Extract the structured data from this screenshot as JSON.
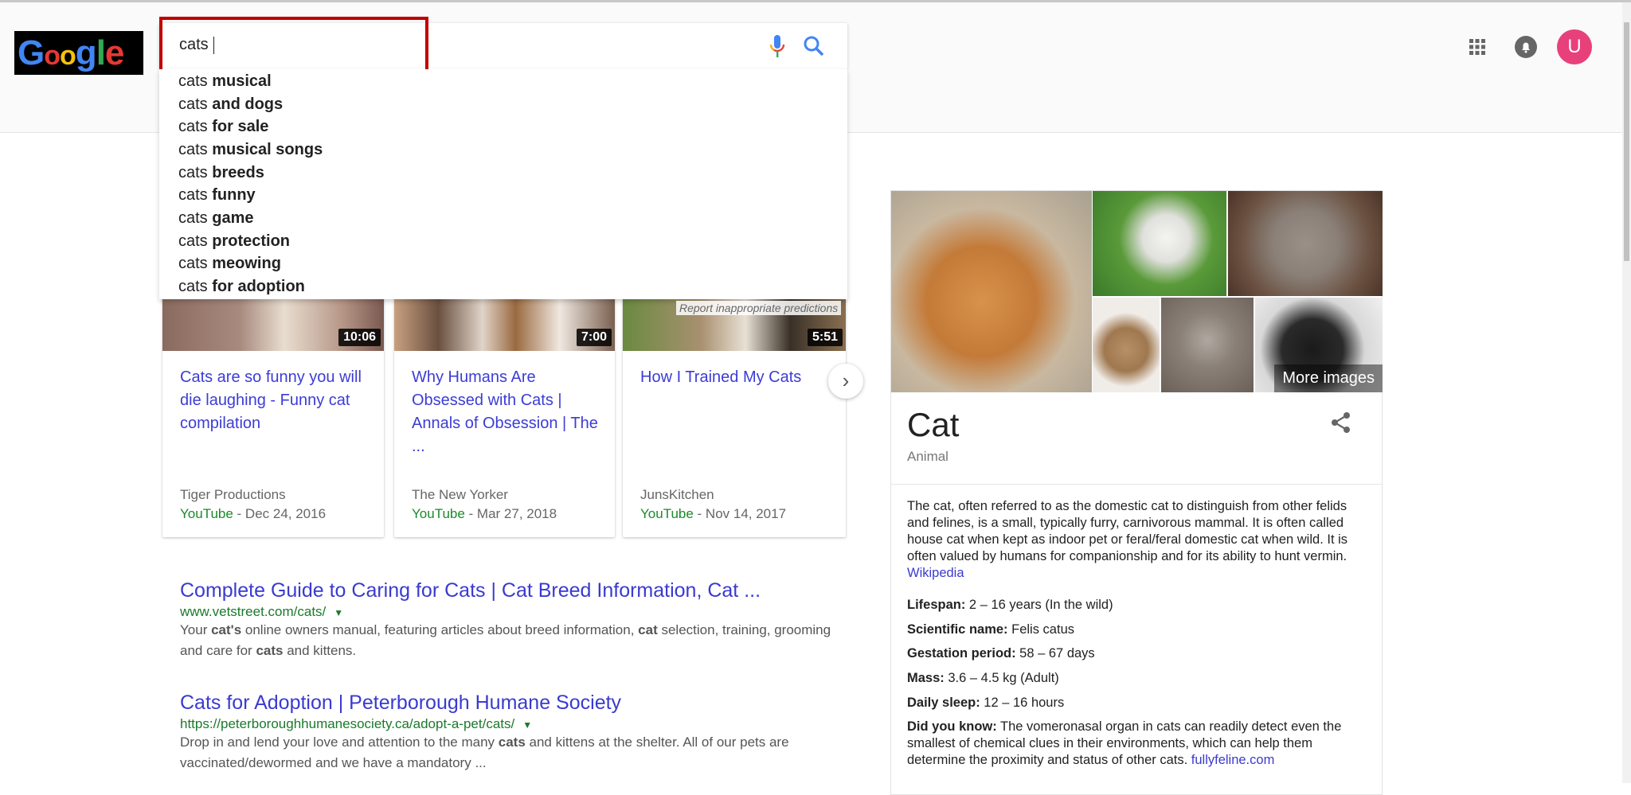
{
  "logo": {
    "text": "Google",
    "letters": [
      "G",
      "o",
      "o",
      "g",
      "l",
      "e"
    ]
  },
  "search": {
    "query": "cats",
    "mic_icon": "mic-icon",
    "search_icon": "search-icon"
  },
  "suggestions": [
    {
      "prefix": "cats",
      "bold": "musical"
    },
    {
      "prefix": "cats",
      "bold": "and dogs"
    },
    {
      "prefix": "cats",
      "bold": "for sale"
    },
    {
      "prefix": "cats",
      "bold": "musical songs"
    },
    {
      "prefix": "cats",
      "bold": "breeds"
    },
    {
      "prefix": "cats",
      "bold": "funny"
    },
    {
      "prefix": "cats",
      "bold": "game"
    },
    {
      "prefix": "cats",
      "bold": "protection"
    },
    {
      "prefix": "cats",
      "bold": "meowing"
    },
    {
      "prefix": "cats",
      "bold": "for adoption"
    }
  ],
  "report_link": "Report inappropriate predictions",
  "header": {
    "apps_icon": "apps-grid-icon",
    "notifications_icon": "bell-icon",
    "avatar_letter": "U",
    "avatar_color": "#e8407a"
  },
  "videos": [
    {
      "duration": "10:06",
      "title": "Cats are so funny you will die laughing - Funny cat compilation",
      "source": "Tiger Productions",
      "platform": "YouTube",
      "date": " - Dec 24, 2016"
    },
    {
      "duration": "7:00",
      "title": "Why Humans Are Obsessed with Cats | Annals of Obsession | The ...",
      "source": "The New Yorker",
      "platform": "YouTube",
      "date": " - Mar 27, 2018"
    },
    {
      "duration": "5:51",
      "title": "How I Trained My Cats",
      "source": "JunsKitchen",
      "platform": "YouTube",
      "date": " - Nov 14, 2017"
    }
  ],
  "results": [
    {
      "title": "Complete Guide to Caring for Cats | Cat Breed Information, Cat ...",
      "url": "www.vetstreet.com/cats/",
      "snippet_html": "Your <b>cat's</b> online owners manual, featuring articles about breed information, <b>cat</b> selection, training, grooming and care for <b>cats</b> and kittens."
    },
    {
      "title": "Cats for Adoption | Peterborough Humane Society",
      "url": "https://peterboroughhumanesociety.ca/adopt-a-pet/cats/",
      "snippet_html": "Drop in and lend your love and attention to the many <b>cats</b> and kittens at the shelter. All of our pets are vaccinated/dewormed and we have a mandatory ..."
    }
  ],
  "knowledge_panel": {
    "more_images": "More images",
    "title": "Cat",
    "subtitle": "Animal",
    "description": "The cat, often referred to as the domestic cat to distinguish from other felids and felines, is a small, typically furry, carnivorous mammal. It is often called house cat when kept as indoor pet or feral/feral domestic cat when wild. It is often valued by humans for companionship and for its ability to hunt vermin. ",
    "description_source": "Wikipedia",
    "facts": [
      {
        "label": "Lifespan:",
        "value": " 2 – 16 years (In the wild)"
      },
      {
        "label": "Scientific name:",
        "value": " Felis catus"
      },
      {
        "label": "Gestation period:",
        "value": " 58 – 67 days"
      },
      {
        "label": "Mass:",
        "value": " 3.6 – 4.5 kg (Adult)"
      },
      {
        "label": "Daily sleep:",
        "value": " 12 – 16 hours"
      }
    ],
    "did_you_know": {
      "label": "Did you know:",
      "value": " The vomeronasal organ in cats can readily detect even the smallest of chemical clues in their environments, which can help them determine the proximity and status of other cats. ",
      "source": "fullyfeline.com"
    }
  }
}
